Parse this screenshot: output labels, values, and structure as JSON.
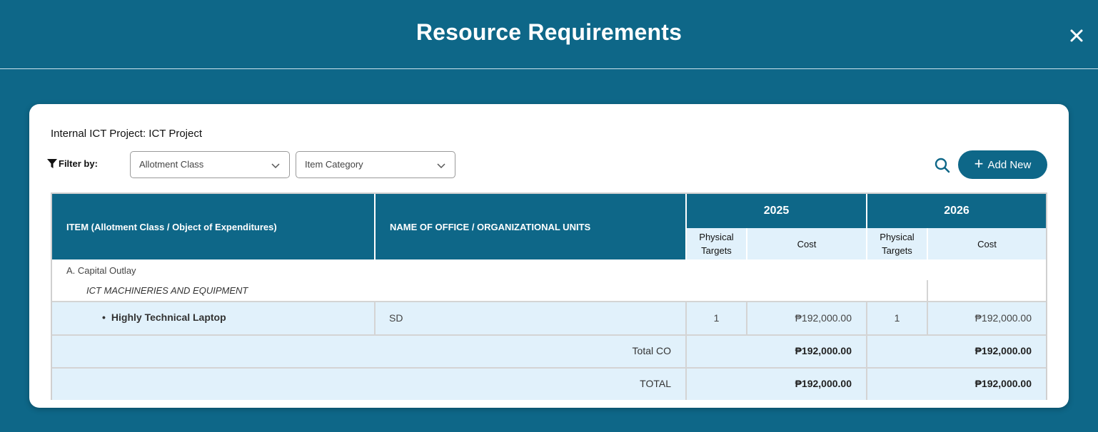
{
  "modal": {
    "title": "Resource Requirements",
    "close_icon": "close-icon"
  },
  "project": {
    "title": "Internal ICT Project: ICT Project"
  },
  "filters": {
    "label": "Filter by:",
    "icon": "filter-icon",
    "allotment_class": "Allotment Class",
    "item_category": "Item Category"
  },
  "toolbar": {
    "search_icon": "search-icon",
    "add_label": "Add New"
  },
  "table": {
    "headers": {
      "item": "ITEM (Allotment Class / Object of Expenditures)",
      "office": "NAME OF OFFICE / ORGANIZATIONAL UNITS",
      "years": [
        "2025",
        "2026"
      ],
      "physical_targets": "Physical Targets",
      "cost": "Cost"
    },
    "allotment_class": "A. Capital Outlay",
    "category": "ICT MACHINERIES AND EQUIPMENT",
    "rows": [
      {
        "item": "Highly Technical Laptop",
        "office": "SD",
        "targets_2025": "1",
        "cost_2025": "₱192,000.00",
        "targets_2026": "1",
        "cost_2026": "₱192,000.00"
      }
    ],
    "total_co": {
      "label": "Total CO",
      "cost_2025": "₱192,000.00",
      "cost_2026": "₱192,000.00"
    },
    "total": {
      "label": "TOTAL",
      "cost_2025": "₱192,000.00",
      "cost_2026": "₱192,000.00"
    }
  }
}
